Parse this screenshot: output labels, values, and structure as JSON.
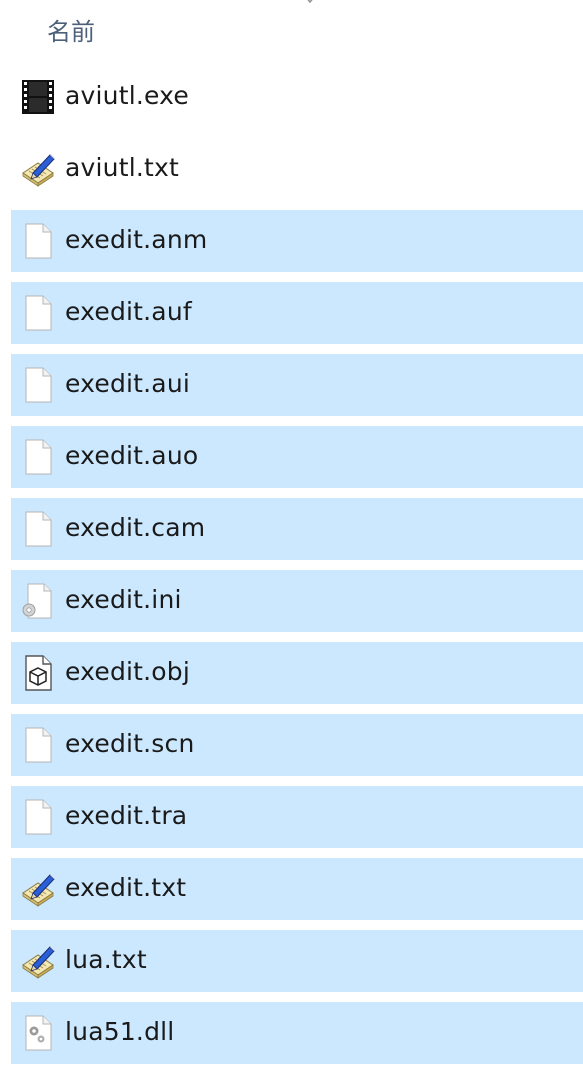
{
  "header": {
    "name_column_label": "名前"
  },
  "files": [
    {
      "name": "aviutl.exe",
      "icon": "video-exe-icon",
      "selected": false
    },
    {
      "name": "aviutl.txt",
      "icon": "text-document-icon",
      "selected": false
    },
    {
      "name": "exedit.anm",
      "icon": "blank-file-icon",
      "selected": true
    },
    {
      "name": "exedit.auf",
      "icon": "blank-file-icon",
      "selected": true
    },
    {
      "name": "exedit.aui",
      "icon": "blank-file-icon",
      "selected": true
    },
    {
      "name": "exedit.auo",
      "icon": "blank-file-icon",
      "selected": true
    },
    {
      "name": "exedit.cam",
      "icon": "blank-file-icon",
      "selected": true
    },
    {
      "name": "exedit.ini",
      "icon": "settings-file-icon",
      "selected": true
    },
    {
      "name": "exedit.obj",
      "icon": "3d-object-file-icon",
      "selected": true
    },
    {
      "name": "exedit.scn",
      "icon": "blank-file-icon",
      "selected": true
    },
    {
      "name": "exedit.tra",
      "icon": "blank-file-icon",
      "selected": true
    },
    {
      "name": "exedit.txt",
      "icon": "text-document-icon",
      "selected": true
    },
    {
      "name": "lua.txt",
      "icon": "text-document-icon",
      "selected": true
    },
    {
      "name": "lua51.dll",
      "icon": "dll-file-icon",
      "selected": true
    }
  ],
  "colors": {
    "selection_background": "#cce8ff",
    "header_text": "#4c607a",
    "file_text": "#1a1a1a"
  }
}
